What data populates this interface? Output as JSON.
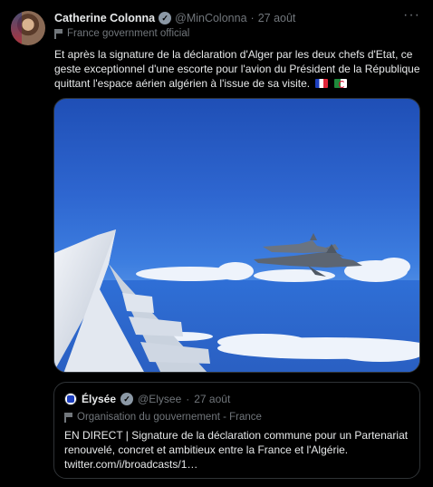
{
  "tweet": {
    "author_name": "Catherine Colonna",
    "handle": "@MinColonna",
    "separator": "·",
    "date": "27 août",
    "account_label": "France government official",
    "more_glyph": "···",
    "text": "Et après la signature de la déclaration d'Alger par les deux chefs d'Etat, ce geste exceptionnel d'une escorte pour l'avion du Président de la République quittant l'espace aérien algérien à l'issue de sa visite."
  },
  "quoted": {
    "author_name": "Élysée",
    "handle": "@Elysee",
    "separator": "·",
    "date": "27 août",
    "account_label": "Organisation du gouvernement - France",
    "text": "EN DIRECT | Signature de la déclaration commune pour un Partenariat renouvelé, concret et ambitieux entre la France et l'Algérie.",
    "link": "twitter.com/i/broadcasts/1…"
  },
  "colors": {
    "background": "#000000",
    "text": "#e7e9ea",
    "muted": "#71767b",
    "border": "#2f3336"
  },
  "icons": {
    "verified": "verified-badge-icon",
    "label": "flag-icon",
    "more": "more-icon",
    "emoji": [
      "france-flag-icon",
      "algeria-flag-icon"
    ]
  }
}
